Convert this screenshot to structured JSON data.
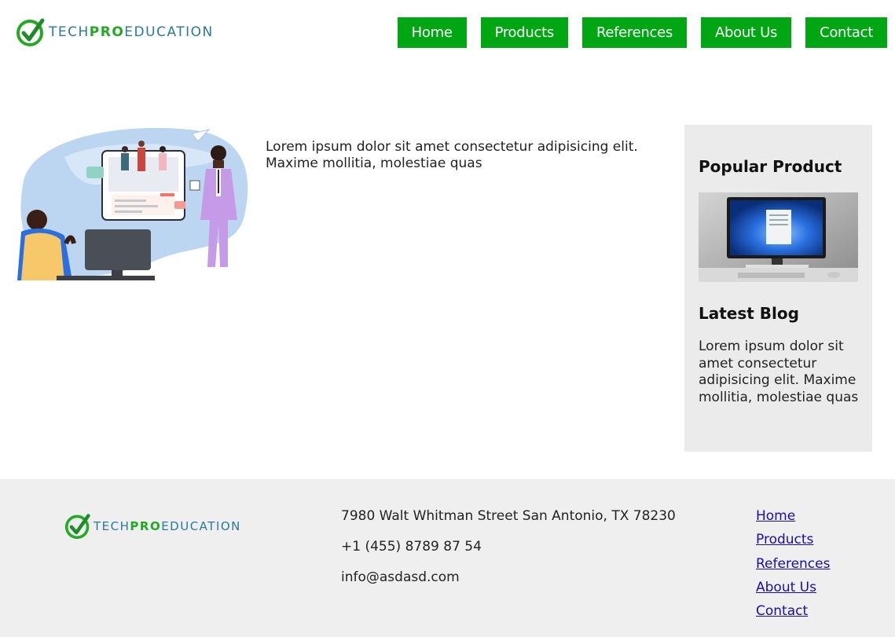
{
  "brand": {
    "logo_parts": [
      "TECH",
      "PRO",
      "EDUCATION"
    ],
    "colors": {
      "accent_green": "#00a713",
      "logo_blue": "#2a7a9a",
      "logo_green": "#22aa22"
    }
  },
  "nav": {
    "items": [
      {
        "label": "Home"
      },
      {
        "label": "Products"
      },
      {
        "label": "References"
      },
      {
        "label": "About Us"
      },
      {
        "label": "Contact"
      }
    ]
  },
  "main": {
    "intro_text": "Lorem ipsum dolor sit amet consectetur adipisicing elit. Maxime mollitia, molestiae quas",
    "hero_image": "illustration-people-online-education"
  },
  "sidebar": {
    "popular_heading": "Popular Product",
    "product_image": "monitor-product-image",
    "blog_heading": "Latest Blog",
    "blog_text": "Lorem ipsum dolor sit amet consectetur adipisicing elit. Maxime mollitia, molestiae quas"
  },
  "footer": {
    "address": "7980 Walt Whitman Street San Antonio, TX 78230",
    "phone": "+1 (455) 8789 87 54",
    "email": "info@asdasd.com",
    "links": [
      {
        "label": "Home"
      },
      {
        "label": "Products"
      },
      {
        "label": "References"
      },
      {
        "label": "About Us"
      },
      {
        "label": "Contact"
      }
    ]
  }
}
